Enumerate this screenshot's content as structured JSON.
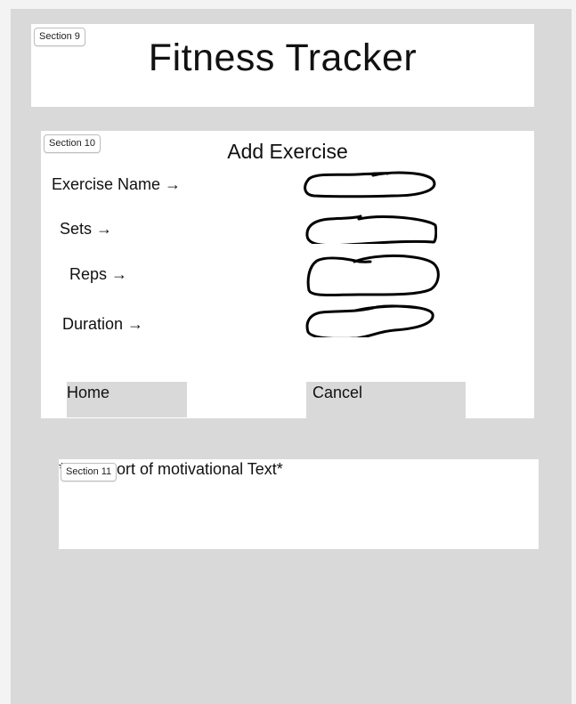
{
  "header": {
    "section_tag": "Section 9",
    "title": "Fitness Tracker"
  },
  "form": {
    "section_tag": "Section 10",
    "title": "Add Exercise",
    "fields": [
      {
        "label": "Exercise Name →",
        "value": ""
      },
      {
        "label": "Sets →",
        "value": ""
      },
      {
        "label": "Reps →",
        "value": ""
      },
      {
        "label": "Duration →",
        "value": ""
      }
    ],
    "buttons": {
      "home": "Home",
      "cancel": "Cancel"
    }
  },
  "motivation": {
    "section_tag": "Section 11",
    "text": "*some sort of motivational Text*"
  },
  "colors": {
    "canvas_bg": "#d9d9d9",
    "panel_bg": "#ffffff",
    "button_bg": "#d9d9d9",
    "ink": "#000000"
  }
}
